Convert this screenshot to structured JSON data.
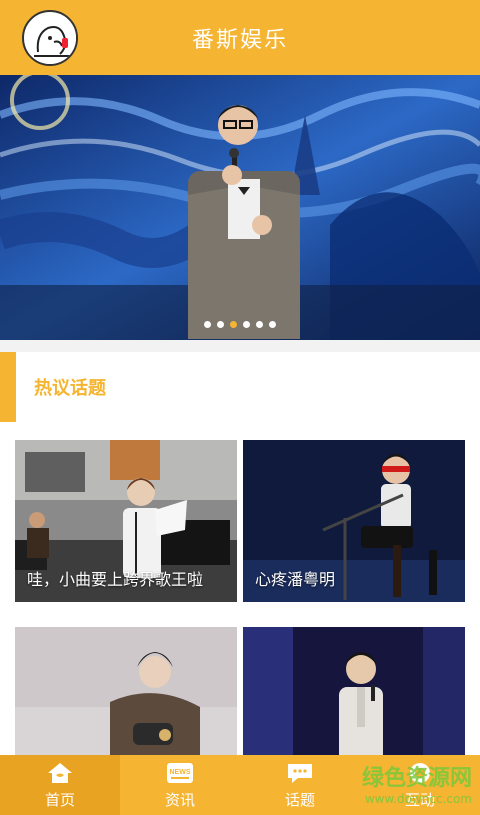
{
  "header": {
    "title": "番斯娱乐"
  },
  "section": {
    "title": "热议话题"
  },
  "cards": [
    {
      "caption": "哇，小曲要上跨界歌王啦"
    },
    {
      "caption": "心疼潘粤明"
    },
    {
      "caption": ""
    },
    {
      "caption": ""
    }
  ],
  "tabs": [
    {
      "label": "首页",
      "icon": "home-icon",
      "active": true
    },
    {
      "label": "资讯",
      "icon": "news-icon",
      "active": false
    },
    {
      "label": "话题",
      "icon": "chat-icon",
      "active": false
    },
    {
      "label": "互动",
      "icon": "interact-icon",
      "active": false
    }
  ],
  "carousel": {
    "count": 6,
    "active_index": 2
  },
  "watermark": {
    "line1": "绿色资源网",
    "line2": "www.downcc.com"
  },
  "colors": {
    "accent": "#f5b431",
    "tab_active": "#e9a322"
  }
}
